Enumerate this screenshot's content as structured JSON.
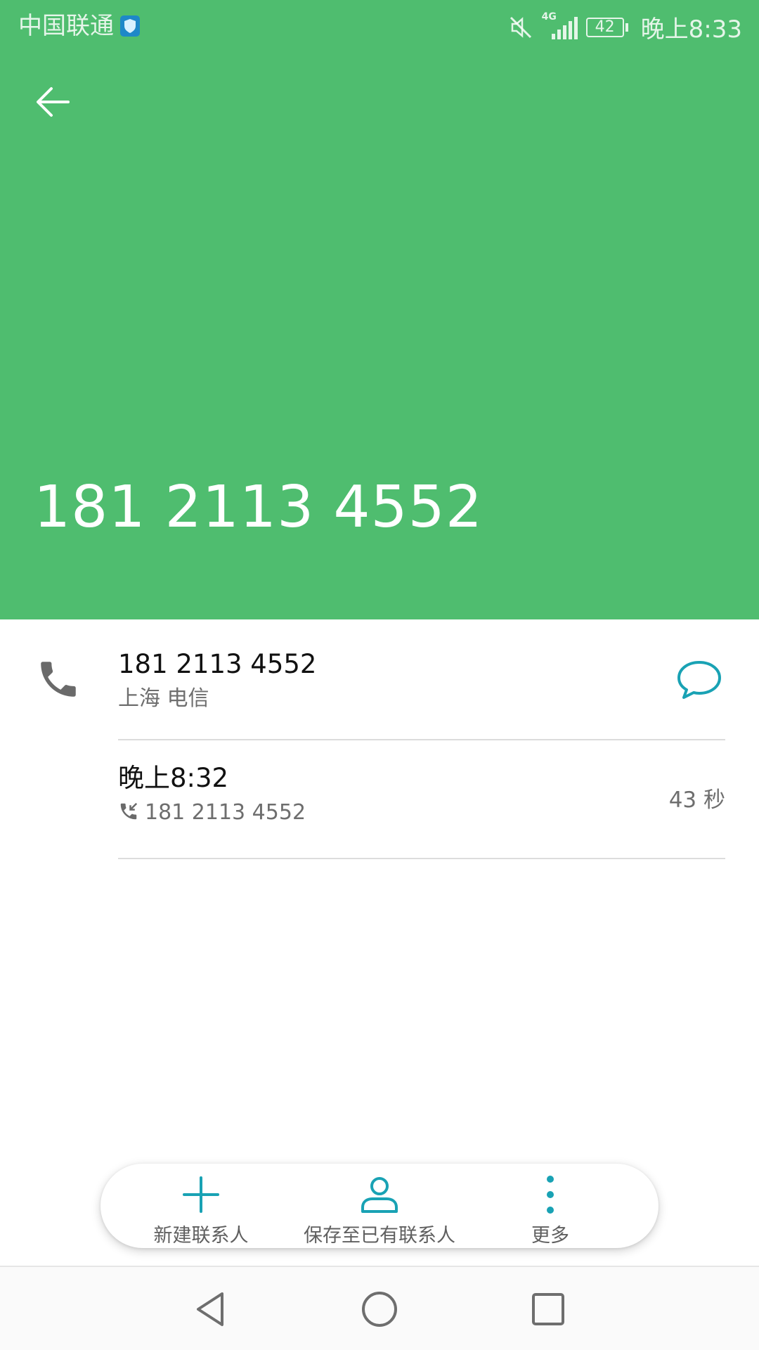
{
  "status_bar": {
    "carrier": "中国联通",
    "network": "4G",
    "battery": "42",
    "time": "晚上8:33"
  },
  "header": {
    "number": "181 2113 4552",
    "color": "#4fbd6f"
  },
  "contact_row": {
    "number": "181 2113 4552",
    "location": "上海 电信"
  },
  "call_log": {
    "time": "晚上8:32",
    "number": "181 2113 4552",
    "duration": "43 秒"
  },
  "actions": {
    "new_contact": "新建联系人",
    "save_existing": "保存至已有联系人",
    "more": "更多"
  },
  "accent_color": "#19a2b4"
}
